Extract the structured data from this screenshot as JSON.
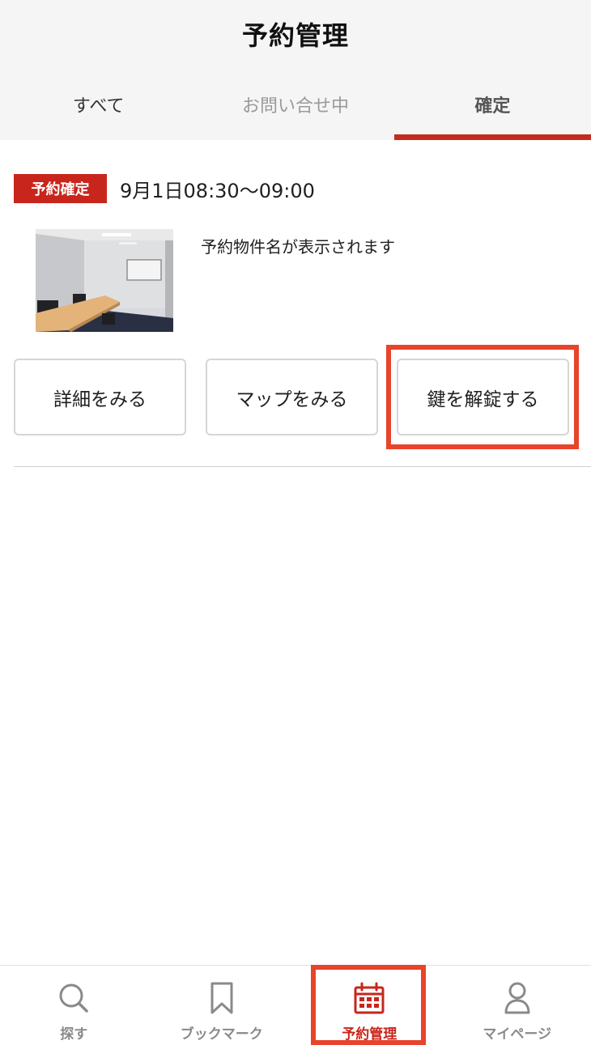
{
  "header": {
    "title": "予約管理"
  },
  "tabs": [
    {
      "label": "すべて"
    },
    {
      "label": "お問い合せ中"
    },
    {
      "label": "確定"
    }
  ],
  "active_tab": "確定",
  "reservation": {
    "status": "予約確定",
    "datetime": "9月1日08:30～09:00",
    "property_name": "予約物件名が表示されます",
    "buttons": {
      "detail": "詳細をみる",
      "map": "マップをみる",
      "unlock": "鍵を解錠する"
    }
  },
  "bottom_nav": [
    {
      "label": "探す",
      "icon": "search-icon"
    },
    {
      "label": "ブックマーク",
      "icon": "bookmark-icon"
    },
    {
      "label": "予約管理",
      "icon": "calendar-icon"
    },
    {
      "label": "マイページ",
      "icon": "user-icon"
    }
  ],
  "active_nav": "予約管理",
  "colors": {
    "accent": "#c8261c",
    "highlight": "#e8432b"
  }
}
